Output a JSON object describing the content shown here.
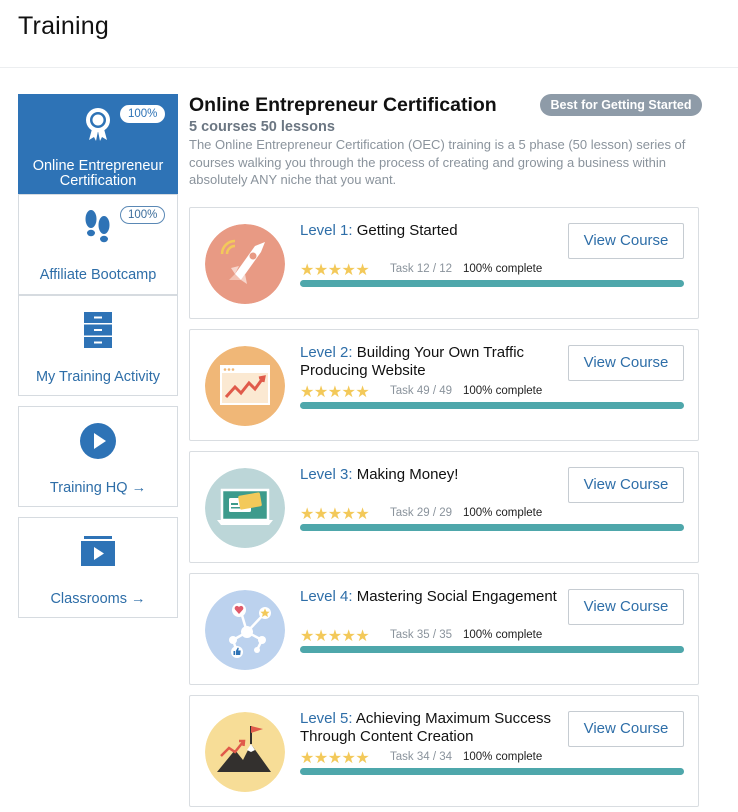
{
  "page": {
    "title": "Training"
  },
  "sidebar": {
    "items": [
      {
        "label": "Online Entrepreneur Certification",
        "badge": "100%",
        "icon": "award-ribbon-icon",
        "active": true
      },
      {
        "label": "Affiliate Bootcamp",
        "badge": "100%",
        "icon": "footprints-icon",
        "active": false
      },
      {
        "label": "My Training Activity",
        "icon": "filing-cabinet-icon",
        "active": false
      },
      {
        "label": "Training HQ →",
        "icon": "play-circle-icon",
        "active": false
      },
      {
        "label": "Classrooms →",
        "icon": "video-classroom-icon",
        "active": false
      }
    ]
  },
  "certification": {
    "title": "Online Entrepreneur Certification",
    "badge": "Best for Getting Started",
    "subtitle": "5 courses 50 lessons",
    "description": "The Online Entrepreneur Certification (OEC) training is a 5 phase (50 lesson) series of courses walking you through the process of creating and growing a business within absolutely ANY niche that you want."
  },
  "levels": [
    {
      "level": "Level 1:",
      "title": "Getting Started",
      "task": "Task 12 / 12",
      "complete": "100% complete",
      "progress": 1.0,
      "stars": "★★★★★",
      "button": "View Course",
      "icon": "rocket-icon"
    },
    {
      "level": "Level 2:",
      "title": "Building Your Own Traffic Producing Website",
      "task": "Task 49 / 49",
      "complete": "100% complete",
      "progress": 1.0,
      "stars": "★★★★★",
      "button": "View Course",
      "icon": "website-growth-icon"
    },
    {
      "level": "Level 3:",
      "title": "Making Money!",
      "task": "Task 29 / 29",
      "complete": "100% complete",
      "progress": 1.0,
      "stars": "★★★★★",
      "button": "View Course",
      "icon": "laptop-payment-icon"
    },
    {
      "level": "Level 4:",
      "title": "Mastering Social Engagement",
      "task": "Task 35 / 35",
      "complete": "100% complete",
      "progress": 1.0,
      "stars": "★★★★★",
      "button": "View Course",
      "icon": "social-network-icon"
    },
    {
      "level": "Level 5:",
      "title": "Achieving Maximum Success Through Content Creation",
      "task": "Task 34 / 34",
      "complete": "100% complete",
      "progress": 1.0,
      "stars": "★★★★★",
      "button": "View Course",
      "icon": "mountain-flag-icon"
    }
  ],
  "colors": {
    "primary": "#2e73b6",
    "progress": "#4ea7ab",
    "star": "#f3c95a",
    "badge": "#8e9ba8"
  }
}
